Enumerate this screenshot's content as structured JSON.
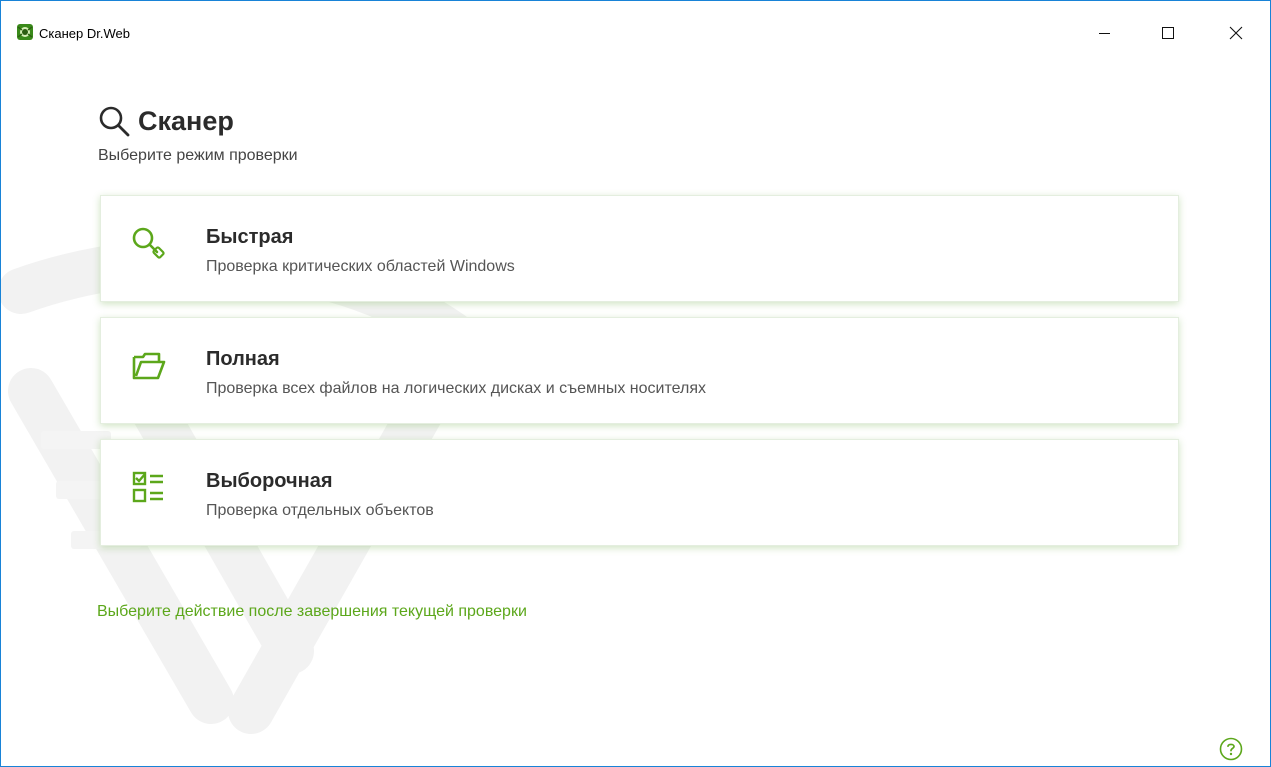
{
  "window": {
    "title": "Сканер Dr.Web",
    "controls": {
      "minimize_icon": "minimize-icon",
      "maximize_icon": "maximize-icon",
      "close_icon": "close-icon"
    }
  },
  "header": {
    "icon": "search-icon",
    "title": "Сканер",
    "subtitle": "Выберите режим проверки"
  },
  "modes": [
    {
      "icon": "quick-scan-icon",
      "title": "Быстрая",
      "description": "Проверка критических областей Windows"
    },
    {
      "icon": "folder-icon",
      "title": "Полная",
      "description": "Проверка всех файлов на логических дисках и съемных носителях"
    },
    {
      "icon": "checklist-icon",
      "title": "Выборочная",
      "description": "Проверка отдельных объектов"
    }
  ],
  "after_scan_link": "Выберите действие после завершения текущей проверки",
  "help_icon": "help-icon",
  "colors": {
    "accent": "#5ca71b",
    "window_border": "#1883d7",
    "card_shadow": "#9fcf7a"
  }
}
